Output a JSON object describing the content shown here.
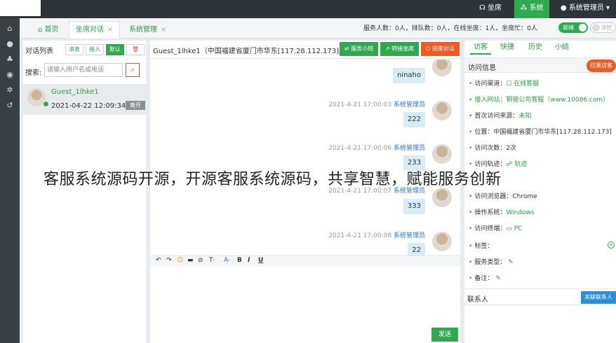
{
  "topbar": {
    "seat_label": "坐席",
    "system_label": "系统",
    "user_label": "系统管理员"
  },
  "tabs": [
    {
      "label": "首页"
    },
    {
      "label": "坐席对话",
      "close": "×"
    },
    {
      "label": "系统管理",
      "close": "×"
    }
  ],
  "status": {
    "stats_text": "服务人数：0人，排队数：0人，在线坐席：1人，坐席忙：0人",
    "ready_label": "就绪",
    "mute_label": "示忙"
  },
  "conversation_list": {
    "title": "对话列表",
    "filters": [
      "消息",
      "接入",
      "默认"
    ],
    "delete_icon": "trash-icon",
    "search_label": "搜索:",
    "search_placeholder": "请输入用户名或电话",
    "items": [
      {
        "name": "Guest_1lhke1",
        "time": "2021-04-22 12:09:34",
        "badge": "离开"
      }
    ]
  },
  "chat": {
    "title": "Guest_1lhke1（中国福建省厦门市华东[117.28.112.173]）",
    "buttons": {
      "summary": "服务小结",
      "transfer": "转接坐席",
      "end": "结束对话"
    },
    "messages": [
      {
        "text": "ninaho"
      },
      {
        "time": "2021-4-21 17:00:03",
        "sender": "系统管理员",
        "text": "222"
      },
      {
        "time": "2021-4-21 17:00:06",
        "sender": "系统管理员",
        "text": "233"
      },
      {
        "time": "2021-4-21 17:00:07",
        "sender": "系统管理员",
        "text": "333"
      },
      {
        "time": "2021-4-21 17:00:08",
        "sender": "系统管理员",
        "text": "22"
      }
    ],
    "toolbar": [
      "↶",
      "↷",
      "☺",
      "▬",
      "⊘",
      "T·",
      "A·",
      "B",
      "I",
      "U"
    ],
    "send_label": "发送"
  },
  "info": {
    "tabs": [
      "访客",
      "快捷",
      "历史",
      "小结"
    ],
    "header": "访问信息",
    "block_label": "拉黑访客",
    "rows": [
      {
        "label": "访问渠道：",
        "value": "在线客服",
        "green": true
      },
      {
        "label": "接入网站：",
        "value": "钢管公司客服（www.10086.com）",
        "green": true
      },
      {
        "label": "首次访问来源：",
        "value": "未知",
        "green": true
      },
      {
        "label": "位置：",
        "value": "中国福建省厦门市华东[117.28.112.173]",
        "green": false
      },
      {
        "label": "访问次数：",
        "value": "2次",
        "green": false
      },
      {
        "label": "访问轨迹：",
        "value": "轨迹",
        "green": true
      },
      {
        "label": "访问浏览器：",
        "value": "Chrome",
        "green": false
      },
      {
        "label": "操作系统：",
        "value": "Windows",
        "green": true
      },
      {
        "label": "访问终端：",
        "value": "PC",
        "green": true
      },
      {
        "label": "标签：",
        "value": "",
        "green": false
      },
      {
        "label": "服务类型：",
        "value": "",
        "green": false
      },
      {
        "label": "备注：",
        "value": "",
        "green": false
      }
    ],
    "contacts_header": "联系人",
    "associate_label": "关联联系人"
  },
  "watermark": "客服系统源码开源，开源客服系统源码，共享智慧，赋能服务创新"
}
